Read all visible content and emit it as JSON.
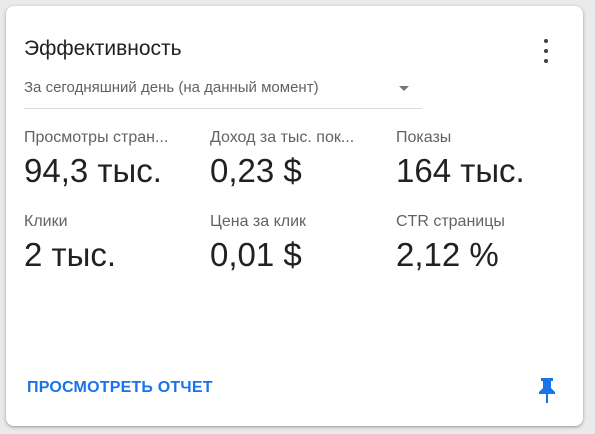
{
  "card": {
    "title": "Эффективность",
    "range": "За сегодняшний день (на данный момент)",
    "metrics": [
      {
        "label": "Просмотры стран...",
        "value": "94,3 тыс."
      },
      {
        "label": "Доход за тыс. пок...",
        "value": "0,23 $"
      },
      {
        "label": "Показы",
        "value": "164 тыс."
      },
      {
        "label": "Клики",
        "value": "2 тыс."
      },
      {
        "label": "Цена за клик",
        "value": "0,01 $"
      },
      {
        "label": "CTR страницы",
        "value": "2,12 %"
      }
    ],
    "report_link": "ПРОСМОТРЕТЬ ОТЧЕТ"
  },
  "colors": {
    "accent": "#1a73e8",
    "text_primary": "#202124",
    "text_secondary": "#5f6368",
    "divider": "#dadce0"
  },
  "icons": {
    "menu": "more-vert-icon",
    "dropdown": "dropdown-arrow-icon",
    "pin": "pin-icon"
  }
}
